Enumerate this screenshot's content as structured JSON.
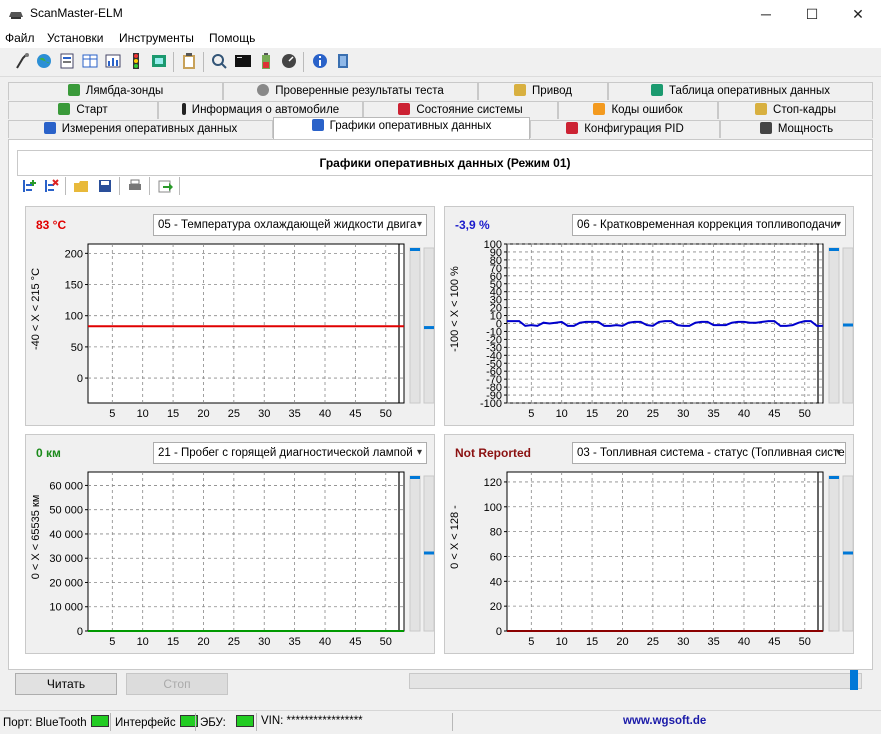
{
  "window": {
    "title": "ScanMaster-ELM",
    "minimize": "─",
    "maximize": "☐",
    "close": "✕"
  },
  "menu": [
    "Файл",
    "Установки",
    "Инструменты",
    "Помощь"
  ],
  "tabs": {
    "row1": [
      "Лямбда-зонды",
      "Проверенные результаты теста",
      "Привод",
      "Таблица оперативных данных"
    ],
    "row2": [
      "Старт",
      "Информация о автомобиле",
      "Состояние системы",
      "Коды ошибок",
      "Стоп-кадры"
    ],
    "row3": [
      "Измерения оперативных данных",
      "Графики оперативных данных",
      "Конфигурация PID",
      "Мощность"
    ],
    "active": "Графики оперативных данных"
  },
  "section_title": "Графики оперативных данных (Режим 01)",
  "charts": [
    {
      "value": "83 °C",
      "value_color": "#e00000",
      "select": "05 - Температура охлаждающей жидкости двига",
      "yaxis_label": "-40  < X <  215  °C",
      "line_color": "#e00000"
    },
    {
      "value": "-3,9 %",
      "value_color": "#1a1acc",
      "select": "06 - Кратковременная коррекция топливоподачи",
      "yaxis_label": "-100  < X <  100  %",
      "line_color": "#0000cc"
    },
    {
      "value": "0 км",
      "value_color": "#1a8a1a",
      "select": "21 - Пробег с горящей диагностической лампой",
      "yaxis_label": "0  < X <  65535  км",
      "line_color": "#009900"
    },
    {
      "value": "Not Reported",
      "value_color": "#8b1010",
      "select": "03 - Топливная система - статус (Топливная систе",
      "yaxis_label": "0  < X <  128  -",
      "line_color": "#8b0000"
    }
  ],
  "chart_data": [
    {
      "type": "line",
      "title": "05 - Температура охлаждающей жидкости двига",
      "xticks": [
        5,
        10,
        15,
        20,
        25,
        30,
        35,
        40,
        45,
        50
      ],
      "yticks": [
        0,
        50,
        100,
        150,
        200
      ],
      "ylim": [
        -40,
        215
      ],
      "xlim": [
        1,
        53
      ],
      "series": [
        {
          "x": [
            1,
            53
          ],
          "values": [
            83,
            83
          ]
        }
      ],
      "gauge_levels": [
        1.0,
        0.483
      ]
    },
    {
      "type": "line",
      "title": "06 - Кратковременная коррекция топливоподачи",
      "xticks": [
        5,
        10,
        15,
        20,
        25,
        30,
        35,
        40,
        45,
        50
      ],
      "yticks": [
        -100,
        -90,
        -80,
        -70,
        -60,
        -50,
        -40,
        -30,
        -20,
        -10,
        0,
        10,
        20,
        30,
        40,
        50,
        60,
        70,
        80,
        90,
        100
      ],
      "ylim": [
        -100,
        100
      ],
      "xlim": [
        1,
        53
      ],
      "series": [
        {
          "x": [
            1,
            3,
            4,
            5,
            6,
            7,
            8,
            9,
            10,
            11,
            12,
            13,
            14,
            15,
            16,
            17,
            18,
            19,
            20,
            21,
            22,
            23,
            24,
            25,
            26,
            27,
            28,
            29,
            30,
            31,
            32,
            33,
            34,
            35,
            36,
            37,
            38,
            39,
            40,
            41,
            42,
            43,
            44,
            45,
            46,
            47,
            48,
            49,
            50,
            51,
            52,
            53
          ],
          "values": [
            3,
            3,
            -3,
            -2,
            -3,
            1,
            0,
            1,
            2,
            -3,
            -3,
            1,
            2,
            2,
            2,
            -3,
            -3,
            -2,
            -3,
            1,
            2,
            2,
            -2,
            -3,
            2,
            3,
            3,
            -2,
            -3,
            -3,
            1,
            2,
            2,
            -2,
            -2,
            -2,
            1,
            2,
            2,
            1,
            1,
            2,
            3,
            3,
            -3,
            -3,
            -2,
            1,
            3,
            3,
            -3,
            -3
          ]
        }
      ],
      "gauge_levels": [
        1.0,
        0.5
      ]
    },
    {
      "type": "line",
      "title": "21 - Пробег с горящей диагностической лампой",
      "xticks": [
        5,
        10,
        15,
        20,
        25,
        30,
        35,
        40,
        45,
        50
      ],
      "yticks": [
        0,
        10000,
        20000,
        30000,
        40000,
        50000,
        60000
      ],
      "ytick_labels": [
        "0",
        "10 000",
        "20 000",
        "30 000",
        "40 000",
        "50 000",
        "60 000"
      ],
      "ylim": [
        0,
        65535
      ],
      "xlim": [
        1,
        53
      ],
      "series": [
        {
          "x": [
            1,
            53
          ],
          "values": [
            0,
            0
          ]
        }
      ],
      "gauge_levels": [
        1.0,
        0.5
      ]
    },
    {
      "type": "line",
      "title": "03 - Топливная система - статус (Топливная систе",
      "xticks": [
        5,
        10,
        15,
        20,
        25,
        30,
        35,
        40,
        45,
        50
      ],
      "yticks": [
        0,
        20,
        40,
        60,
        80,
        100,
        120
      ],
      "ylim": [
        0,
        128
      ],
      "xlim": [
        1,
        53
      ],
      "series": [
        {
          "x": [
            1,
            53
          ],
          "values": [
            0,
            0
          ]
        }
      ],
      "gauge_levels": [
        1.0,
        0.5
      ]
    }
  ],
  "buttons": {
    "read": "Читать",
    "stop": "Стоп"
  },
  "status": {
    "port": "Порт: BlueTooth",
    "interface": "Интерфейс",
    "ecu": "ЭБУ:",
    "vin": "VIN: *****************",
    "website": "www.wgsoft.de"
  }
}
